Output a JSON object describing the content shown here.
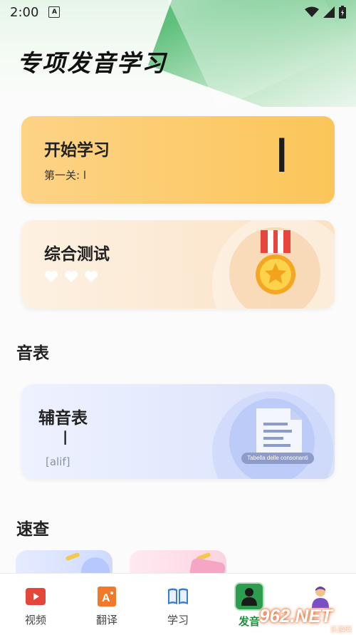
{
  "status_bar": {
    "time": "2:00",
    "notification_icon": "A"
  },
  "page_title": "专项发音学习",
  "start_card": {
    "title": "开始学习",
    "level_text": "第一关: ا",
    "letter": "ا"
  },
  "test_card": {
    "title": "综合测试",
    "hearts": 3,
    "medal_icon": "medal-star-icon"
  },
  "sections": {
    "phonetic": "音表",
    "quick": "速查"
  },
  "consonant_card": {
    "title": "辅音表",
    "letter": "ا",
    "transliteration": "[alif]",
    "doc_label": "Tabella delle consonanti"
  },
  "tabs": [
    {
      "label": "视频",
      "icon": "video-icon"
    },
    {
      "label": "翻译",
      "icon": "translate-icon"
    },
    {
      "label": "学习",
      "icon": "book-icon"
    },
    {
      "label": "发音",
      "icon": "pronunciation-icon",
      "active": true
    },
    {
      "label": "",
      "icon": "profile-icon"
    }
  ],
  "watermark": {
    "text": "962.NET",
    "sub": "乐游网"
  },
  "colors": {
    "accent_green": "#1f8f3f",
    "start_card": "#fbc559",
    "test_card": "#fbe2c6",
    "consonant_card": "#d9e1fb"
  }
}
